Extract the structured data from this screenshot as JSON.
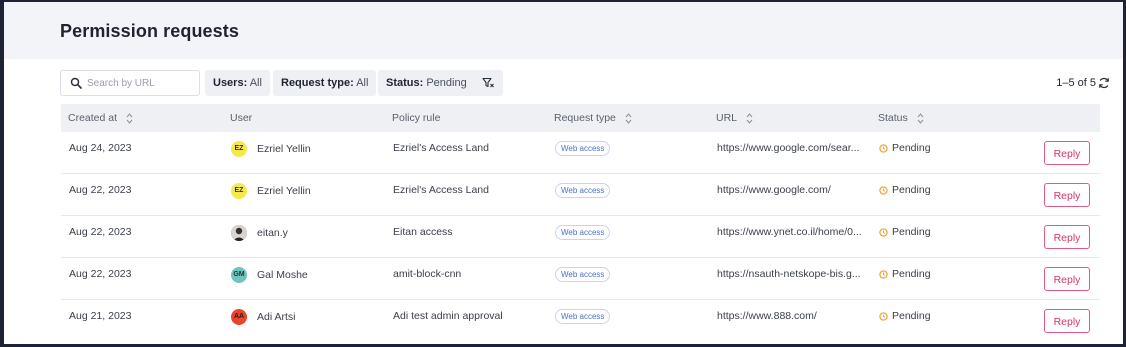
{
  "page": {
    "title": "Permission requests"
  },
  "toolbar": {
    "search_placeholder": "Search by URL",
    "filters": [
      {
        "label": "Users:",
        "value": "All"
      },
      {
        "label": "Request type:",
        "value": "All"
      },
      {
        "label": "Status:",
        "value": "Pending"
      }
    ],
    "pager_text": "1–5 of 5"
  },
  "table": {
    "columns": [
      "Created at",
      "User",
      "Policy rule",
      "Request type",
      "URL",
      "Status"
    ],
    "rows": [
      {
        "created": "Aug 24, 2023",
        "avatar": "EZ",
        "avatar_color": "#f5e84a",
        "user": "Ezriel Yellin",
        "policy": "Ezriel's Access Land",
        "type": "Web access",
        "url": "https://www.google.com/sear...",
        "status": "Pending",
        "action": "Reply"
      },
      {
        "created": "Aug 22, 2023",
        "avatar": "EZ",
        "avatar_color": "#f5e84a",
        "user": "Ezriel Yellin",
        "policy": "Ezriel's Access Land",
        "type": "Web access",
        "url": "https://www.google.com/",
        "status": "Pending",
        "action": "Reply"
      },
      {
        "created": "Aug 22, 2023",
        "avatar": "",
        "avatar_color": "#8a6a5a",
        "user": "eitan.y",
        "policy": "Eitan access",
        "type": "Web access",
        "url": "https://www.ynet.co.il/home/0...",
        "status": "Pending",
        "action": "Reply"
      },
      {
        "created": "Aug 22, 2023",
        "avatar": "GM",
        "avatar_color": "#6ec5bc",
        "user": "Gal Moshe",
        "policy": "amit-block-cnn",
        "type": "Web access",
        "url": "https://nsauth-netskope-bis.g...",
        "status": "Pending",
        "action": "Reply"
      },
      {
        "created": "Aug 21, 2023",
        "avatar": "AA",
        "avatar_color": "#e8452c",
        "user": "Adi Artsi",
        "policy": "Adi test admin approval",
        "type": "Web access",
        "url": "https://www.888.com/",
        "status": "Pending",
        "action": "Reply"
      }
    ]
  },
  "colors": {
    "accent": "#d6336c",
    "status_pending": "#f0a030",
    "badge": "#4a6fd0"
  }
}
